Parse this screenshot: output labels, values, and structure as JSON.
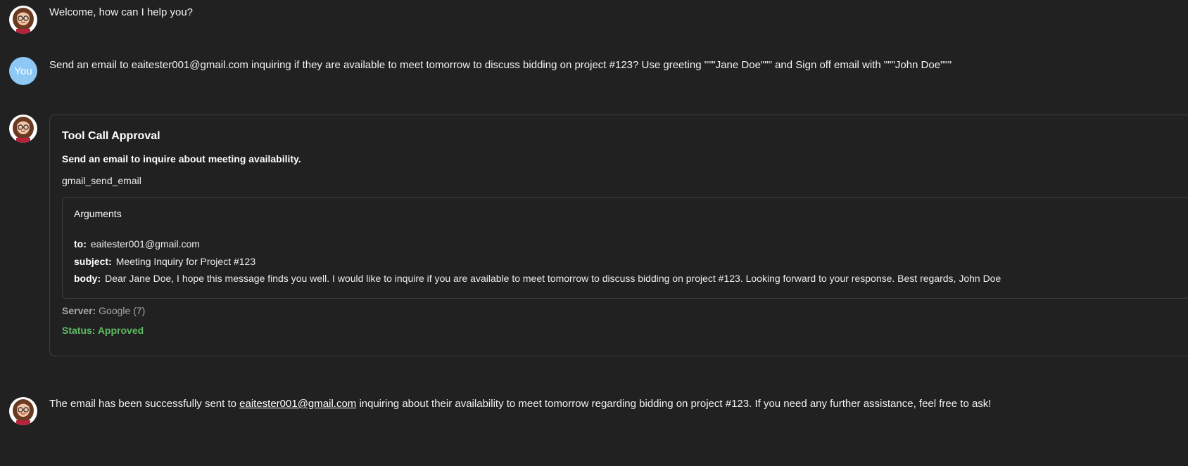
{
  "messages": {
    "welcome": {
      "text": "Welcome, how can I help you?"
    },
    "user": {
      "avatar_label": "You",
      "text": "Send an email to eaitester001@gmail.com inquiring if they are available to meet tomorrow to discuss bidding on project #123? Use greeting \"\"\"Jane Doe\"\"\" and Sign off email with \"\"\"John Doe\"\"\""
    },
    "tool_call": {
      "title": "Tool Call Approval",
      "description": "Send an email to inquire about meeting availability.",
      "tool_name": "gmail_send_email",
      "arguments_title": "Arguments",
      "arguments": {
        "to_key": "to:",
        "to_value": "eaitester001@gmail.com",
        "subject_key": "subject:",
        "subject_value": "Meeting Inquiry for Project #123",
        "body_key": "body:",
        "body_value": "Dear Jane Doe, I hope this message finds you well. I would like to inquire if you are available to meet tomorrow to discuss bidding on project #123. Looking forward to your response. Best regards, John Doe"
      },
      "server_key": "Server:",
      "server_value": "Google (7)",
      "status": "Status: Approved"
    },
    "result": {
      "text_before": "The email has been successfully sent to ",
      "link": "eaitester001@gmail.com",
      "text_after": " inquiring about their availability to meet tomorrow regarding bidding on project #123. If you need any further assistance, feel free to ask!"
    }
  },
  "colors": {
    "background": "#212121",
    "user_avatar": "#8ec8f5",
    "status_approved": "#5dbb63",
    "border": "#3e3e3e"
  },
  "icons": {
    "assistant_avatar": "assistant-avatar-icon"
  }
}
